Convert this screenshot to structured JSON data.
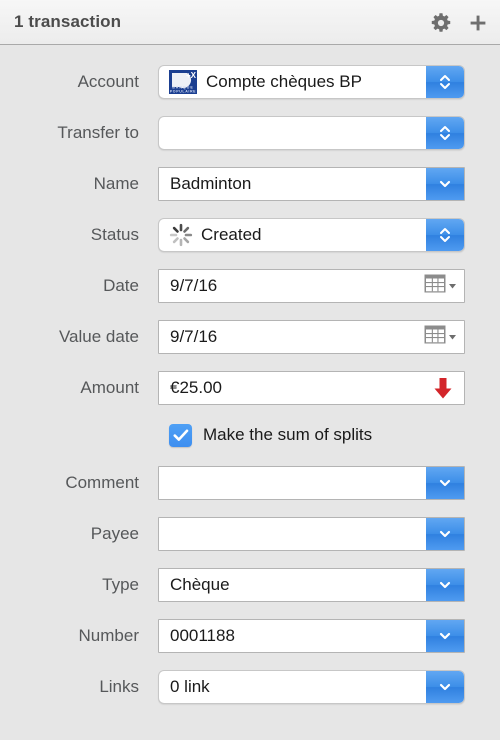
{
  "window": {
    "title": "1 transaction",
    "settings_icon": "gear-icon",
    "add_icon": "plus-icon"
  },
  "colors": {
    "accent_blue": "#3d8ee8",
    "expense_red": "#d3252a",
    "bank_logo_blue": "#1b3f91",
    "background": "#e6e6e6",
    "label_text": "#56585a",
    "field_text": "#1a1a1a"
  },
  "form": {
    "fields": [
      {
        "label": "Account",
        "value": "Compte chèques BP",
        "placeholder": "",
        "control": "stepper",
        "style": "rounded",
        "icon": "bank-logo-banque-populaire"
      },
      {
        "label": "Transfer to",
        "value": "",
        "placeholder": "",
        "control": "stepper",
        "style": "rounded",
        "icon": ""
      },
      {
        "label": "Name",
        "value": "Badminton",
        "placeholder": "",
        "control": "chevron",
        "style": "square",
        "icon": ""
      },
      {
        "label": "Status",
        "value": "Created",
        "placeholder": "",
        "control": "stepper",
        "style": "rounded",
        "icon": "spinner-icon"
      },
      {
        "label": "Date",
        "value": "9/7/16",
        "placeholder": "",
        "control": "calendar",
        "style": "square",
        "icon": ""
      },
      {
        "label": "Value date",
        "value": "9/7/16",
        "placeholder": "",
        "control": "calendar",
        "style": "square",
        "icon": ""
      },
      {
        "label": "Amount",
        "value": "€25.00",
        "placeholder": "",
        "control": "expense-arrow",
        "style": "square",
        "icon": ""
      }
    ],
    "checkbox": {
      "label": "Make the sum of splits",
      "checked": true
    },
    "fields_lower": [
      {
        "label": "Comment",
        "value": "",
        "placeholder": "",
        "control": "chevron",
        "style": "square",
        "icon": ""
      },
      {
        "label": "Payee",
        "value": "",
        "placeholder": "",
        "control": "chevron",
        "style": "square",
        "icon": ""
      },
      {
        "label": "Type",
        "value": "Chèque",
        "placeholder": "",
        "control": "chevron",
        "style": "square",
        "icon": ""
      },
      {
        "label": "Number",
        "value": "0001188",
        "placeholder": "",
        "control": "chevron",
        "style": "square",
        "icon": ""
      },
      {
        "label": "Links",
        "value": "0 link",
        "placeholder": "",
        "control": "chevron",
        "style": "rounded",
        "icon": ""
      }
    ]
  }
}
